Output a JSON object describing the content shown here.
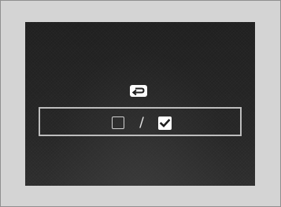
{
  "screen": {
    "back_icon": "return-arrow-icon",
    "options": {
      "unchecked": {
        "icon": "checkbox-unchecked-icon",
        "state": "off"
      },
      "separator": "/",
      "checked": {
        "icon": "checkbox-checked-icon",
        "state": "on"
      }
    }
  },
  "colors": {
    "frame": "#d4d4d4",
    "screen_bg": "#242424",
    "option_border": "#bdbdbd",
    "icon_fill": "#ffffff"
  }
}
